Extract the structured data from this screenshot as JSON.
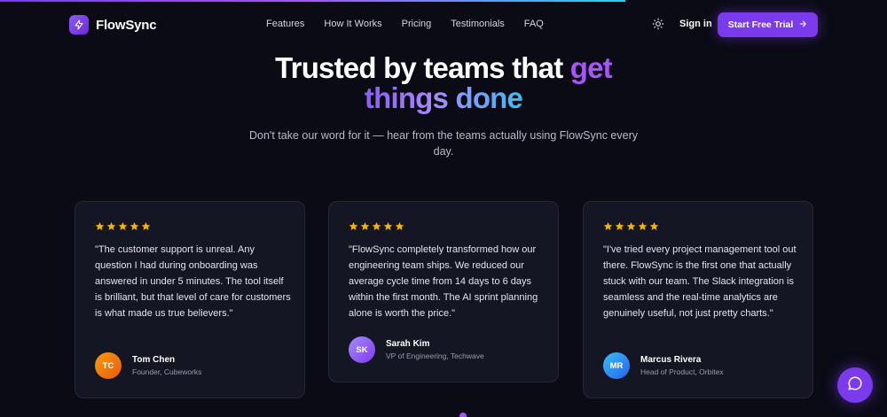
{
  "colors": {
    "accent": "#7c3aed",
    "background": "#0b0b16",
    "card": "#151624",
    "star": "#f5b400"
  },
  "page": {
    "scroll_progress": 0.705
  },
  "nav": {
    "brand": "FlowSync",
    "links": [
      "Features",
      "How It Works",
      "Pricing",
      "Testimonials",
      "FAQ"
    ],
    "signin": "Sign in",
    "cta": "Start Free Trial"
  },
  "hero": {
    "title_part1": "Trusted by teams that ",
    "title_accent1": "get",
    "title_accent2": "things done",
    "subtitle": "Don't take our word for it — hear from the teams actually using FlowSync every day."
  },
  "testimonials": [
    {
      "rating": 5,
      "quote": "\"The customer support is unreal. Any question I had during onboarding was answered in under 5 minutes. The tool itself is brilliant, but that level of care for customers is what made us true believers.\"",
      "initials": "TC",
      "name": "Tom Chen",
      "role": "Founder, Cubeworks",
      "avatar_color": "#f59e0b"
    },
    {
      "rating": 5,
      "quote": "\"FlowSync completely transformed how our engineering team ships. We reduced our average cycle time from 14 days to 6 days within the first month. The AI sprint planning alone is worth the price.\"",
      "initials": "SK",
      "name": "Sarah Kim",
      "role": "VP of Engineering, Techwave",
      "avatar_color": "#8b5cf6"
    },
    {
      "rating": 5,
      "quote": "\"I've tried every project management tool out there. FlowSync is the first one that actually stuck with our team. The Slack integration is seamless and the real-time analytics are genuinely useful, not just pretty charts.\"",
      "initials": "MR",
      "name": "Marcus Rivera",
      "role": "Head of Product, Orbitex",
      "avatar_color": "#3b82f6"
    }
  ]
}
